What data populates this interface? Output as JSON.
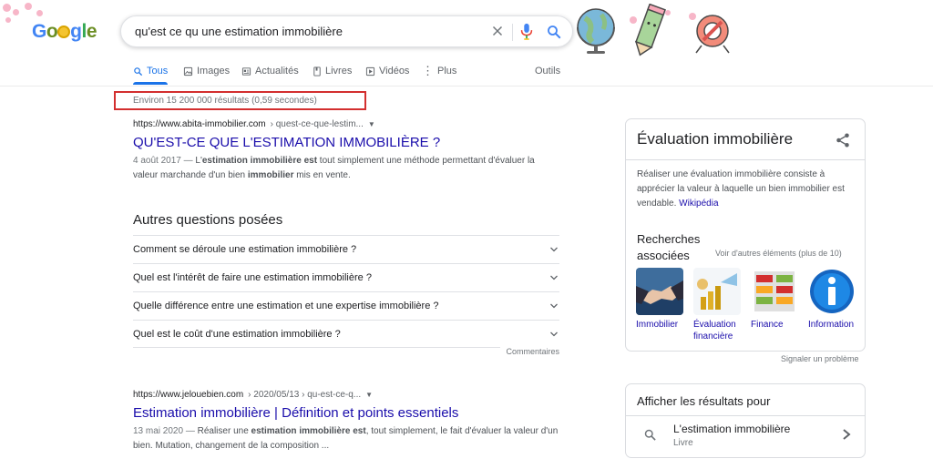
{
  "logo": {
    "text": "Google"
  },
  "search": {
    "query": "qu'est ce qu une estimation immobilière"
  },
  "tabs": [
    {
      "label": "Tous",
      "icon": "search-icon"
    },
    {
      "label": "Images",
      "icon": "image-icon"
    },
    {
      "label": "Actualités",
      "icon": "news-icon"
    },
    {
      "label": "Livres",
      "icon": "book-icon"
    },
    {
      "label": "Vidéos",
      "icon": "video-icon"
    },
    {
      "label": "Plus",
      "icon": "more-icon"
    }
  ],
  "tools_label": "Outils",
  "stats": "Environ 15 200 000 résultats (0,59 secondes)",
  "colors": {
    "link": "#1a0dab",
    "accent": "#1a73e8",
    "highlight_box": "#d32f2f"
  },
  "results": [
    {
      "url": "https://www.abita-immobilier.com",
      "crumb": "› quest-ce-que-lestim...",
      "title": "QU'EST-CE QUE L'ESTIMATION IMMOBILIÈRE ?",
      "date": "4 août 2017 —",
      "snippet_parts": [
        "L'",
        "estimation immobilière est",
        " tout simplement une méthode permettant d'évaluer la valeur marchande d'un bien ",
        "immobilier",
        " mis en vente."
      ]
    },
    {
      "url": "https://www.jelouebien.com",
      "crumb": "› 2020/05/13 › qu-est-ce-q...",
      "title": "Estimation immobilière | Définition et points essentiels",
      "date": "13 mai 2020 —",
      "snippet_parts": [
        "Réaliser une ",
        "estimation immobilière est",
        ", tout simplement, le fait d'évaluer la valeur d'un bien. Mutation, changement de la composition ..."
      ]
    }
  ],
  "paa": {
    "title": "Autres questions posées",
    "questions": [
      "Comment se déroule une estimation immobilière ?",
      "Quel est l'intérêt de faire une estimation immobilière ?",
      "Quelle différence entre une estimation et une expertise immobilière ?",
      "Quel est le coût d'une estimation immobilière ?"
    ],
    "feedback": "Commentaires"
  },
  "knowledge_panel": {
    "title": "Évaluation immobilière",
    "description": "Réaliser une évaluation immobilière consiste à apprécier la valeur à laquelle un bien immobilier est vendable.",
    "source": "Wikipédia",
    "related_title": "Recherches associées",
    "see_more": "Voir d'autres éléments (plus de 10)",
    "related": [
      {
        "label": "Immobilier"
      },
      {
        "label": "Évaluation financière"
      },
      {
        "label": "Finance"
      },
      {
        "label": "Information"
      }
    ],
    "report": "Signaler un problème"
  },
  "results_for": {
    "title": "Afficher les résultats pour",
    "item": "L'estimation immobilière",
    "sub": "Livre"
  }
}
